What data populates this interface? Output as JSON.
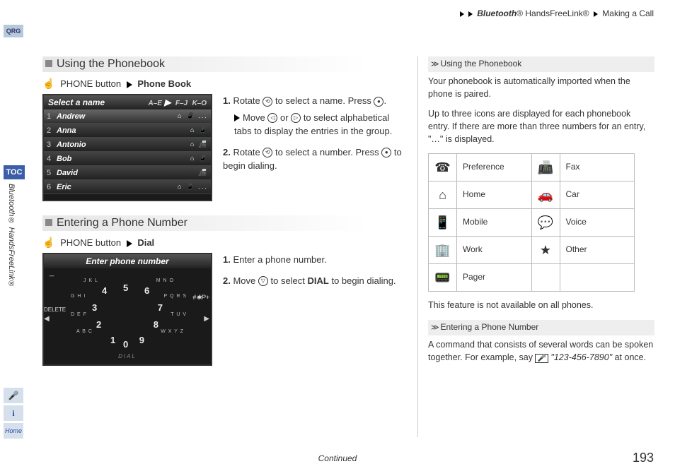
{
  "breadcrumb": {
    "a": "Bluetooth",
    "a_suffix": "® HandsFreeLink®",
    "b": "Making a Call"
  },
  "tabs": {
    "qrg": "QRG",
    "toc": "TOC",
    "side": "Bluetooth® HandsFreeLink®",
    "home": "Home"
  },
  "section1": {
    "title": "Using the Phonebook",
    "path_btn": "PHONE button",
    "path_dest": "Phone Book",
    "screen_title": "Select a name",
    "alpha_tabs": [
      "A–E",
      "F–J",
      "K–O"
    ],
    "entries": [
      {
        "n": "1",
        "name": "Andrew"
      },
      {
        "n": "2",
        "name": "Anna"
      },
      {
        "n": "3",
        "name": "Antonio"
      },
      {
        "n": "4",
        "name": "Bob"
      },
      {
        "n": "5",
        "name": "David"
      },
      {
        "n": "6",
        "name": "Eric"
      }
    ],
    "step1a": "Rotate ",
    "step1b": " to select a name. Press ",
    "step1c": ".",
    "step1d": "Move ",
    "step1e": " or ",
    "step1f": " to select alphabetical tabs to display the entries in the group.",
    "step2a": "Rotate ",
    "step2b": " to select a number. Press ",
    "step2c": " to begin dialing."
  },
  "section2": {
    "title": "Entering a Phone Number",
    "path_btn": "PHONE button",
    "path_dest": "Dial",
    "screen_title": "Enter phone number",
    "step1": "Enter a phone number.",
    "step2a": "Move ",
    "step2b": " to select ",
    "step2c": "DIAL",
    "step2d": " to begin dialing.",
    "labels": {
      "delete": "DELETE",
      "sp": "#✱P+",
      "dial": "DIAL"
    },
    "keys": [
      "1",
      "2",
      "3",
      "4",
      "5",
      "6",
      "7",
      "8",
      "9",
      "0"
    ],
    "sublabels": {
      "2": "A B C",
      "3": "D E F",
      "4": "G H I",
      "5": "J K L",
      "6": "M N O",
      "7": "P Q R S",
      "8": "T U V",
      "9": "W X Y Z"
    }
  },
  "sidebar1": {
    "title": "Using the Phonebook",
    "p1": "Your phonebook is automatically imported when the phone is paired.",
    "p2": "Up to three icons are displayed for each phonebook entry. If there are more than three numbers for an entry, \"…\" is displayed.",
    "icons": [
      {
        "icon": "☎",
        "label": "Preference"
      },
      {
        "icon": "📠",
        "label": "Fax"
      },
      {
        "icon": "⌂",
        "label": "Home"
      },
      {
        "icon": "🚗",
        "label": "Car"
      },
      {
        "icon": "📱",
        "label": "Mobile"
      },
      {
        "icon": "💬",
        "label": "Voice"
      },
      {
        "icon": "🏢",
        "label": "Work"
      },
      {
        "icon": "★",
        "label": "Other"
      },
      {
        "icon": "📟",
        "label": "Pager"
      }
    ],
    "p3": "This feature is not available on all phones."
  },
  "sidebar2": {
    "title": "Entering a Phone Number",
    "p1a": "A command that consists of several words can be spoken together. For example, say ",
    "p1b": "\"123-456-7890\"",
    "p1c": " at once."
  },
  "footer": {
    "continued": "Continued",
    "page": "193"
  }
}
